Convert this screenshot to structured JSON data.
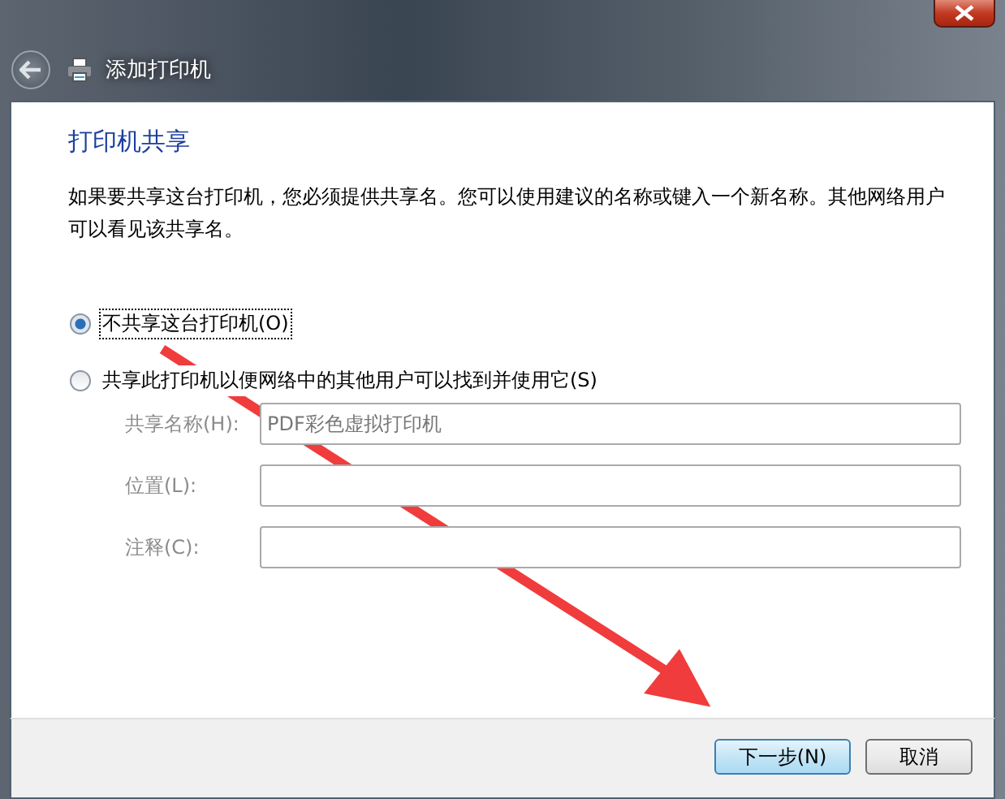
{
  "window": {
    "title": "添加打印机"
  },
  "heading": "打印机共享",
  "description": "如果要共享这台打印机，您必须提供共享名。您可以使用建议的名称或键入一个新名称。其他网络用户可以看见该共享名。",
  "options": [
    {
      "label": "不共享这台打印机(O)",
      "selected": true
    },
    {
      "label": "共享此打印机以便网络中的其他用户可以找到并使用它(S)",
      "selected": false
    }
  ],
  "fields": [
    {
      "label": "共享名称(H):",
      "value": "PDF彩色虚拟打印机",
      "disabled": true
    },
    {
      "label": "位置(L):",
      "disabled": true
    },
    {
      "label": "注释(C):",
      "disabled": true
    }
  ],
  "buttons": [
    {
      "label": "下一步(N)",
      "default": true
    },
    {
      "label": "取消",
      "default": false
    }
  ]
}
